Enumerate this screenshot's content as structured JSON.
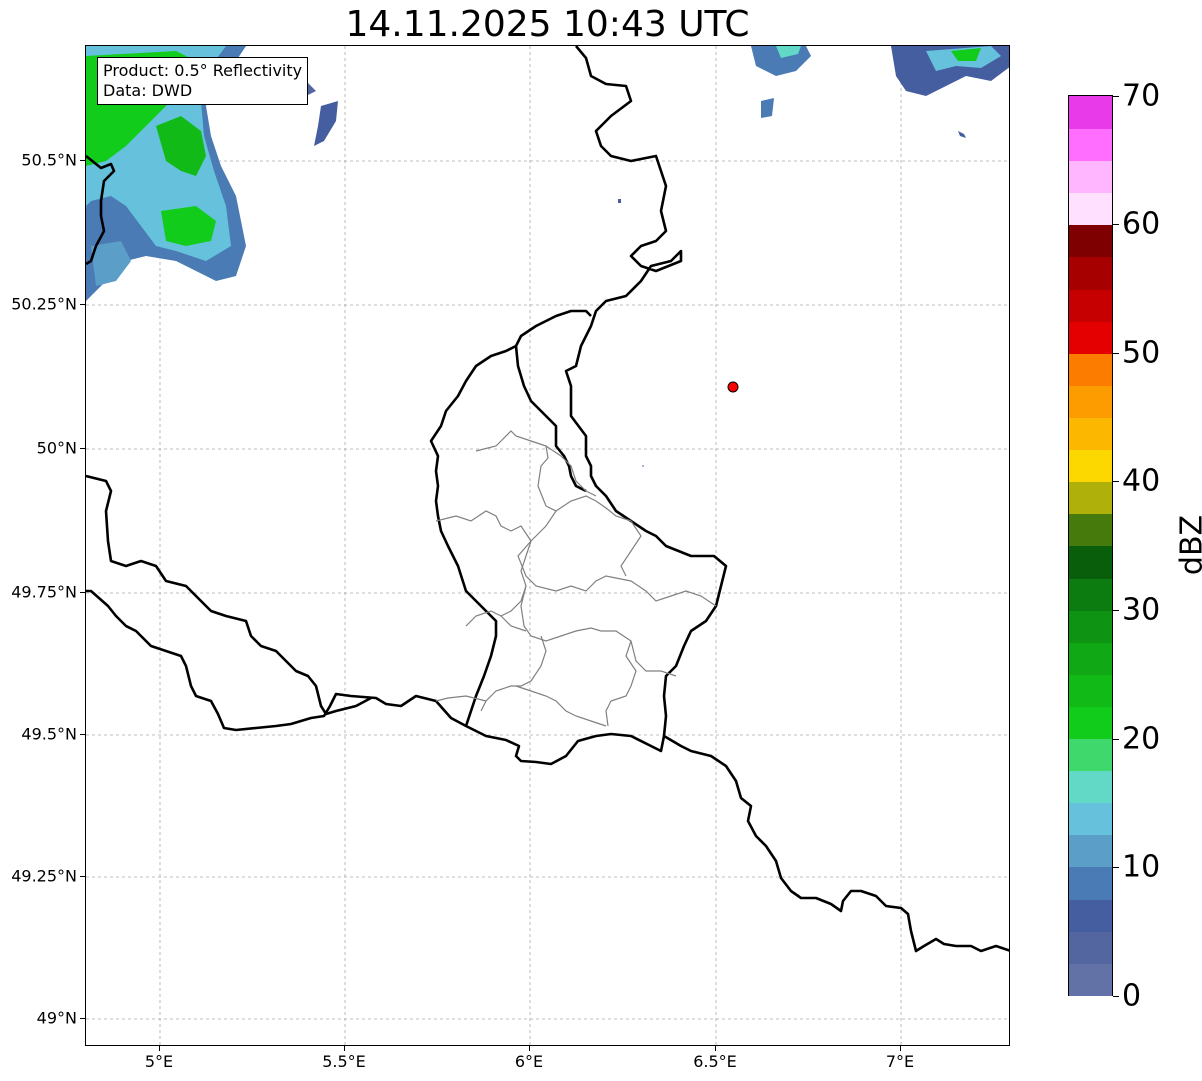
{
  "title": "14.11.2025 10:43 UTC",
  "info_box": {
    "line1": "Product: 0.5° Reflectivity",
    "line2": "Data: DWD"
  },
  "axes": {
    "lat_ticks": [
      "50.5°N",
      "50.25°N",
      "50°N",
      "49.75°N",
      "49.5°N",
      "49.25°N",
      "49°N"
    ],
    "lon_ticks": [
      "5°E",
      "5.5°E",
      "6°E",
      "6.5°E",
      "7°E"
    ]
  },
  "colorbar": {
    "label": "dBZ",
    "tick_labels": [
      "0",
      "10",
      "20",
      "30",
      "40",
      "50",
      "60",
      "70"
    ],
    "colors": [
      "#6272a6",
      "#5466a0",
      "#445ea0",
      "#4a7bb4",
      "#5b9ec8",
      "#66c2dc",
      "#62d8c6",
      "#3ed86c",
      "#12cc1c",
      "#12ba18",
      "#10a814",
      "#0e9412",
      "#0c7c10",
      "#085e0a",
      "#467a0c",
      "#afb00a",
      "#fcd800",
      "#fcb800",
      "#fc9c00",
      "#fc7c00",
      "#e40000",
      "#c60000",
      "#a60000",
      "#7e0000",
      "#ffe0ff",
      "#ffb6ff",
      "#ff6eff",
      "#e83ae8"
    ]
  },
  "marker": {
    "name": "radar-site",
    "color": "#ff0000"
  }
}
